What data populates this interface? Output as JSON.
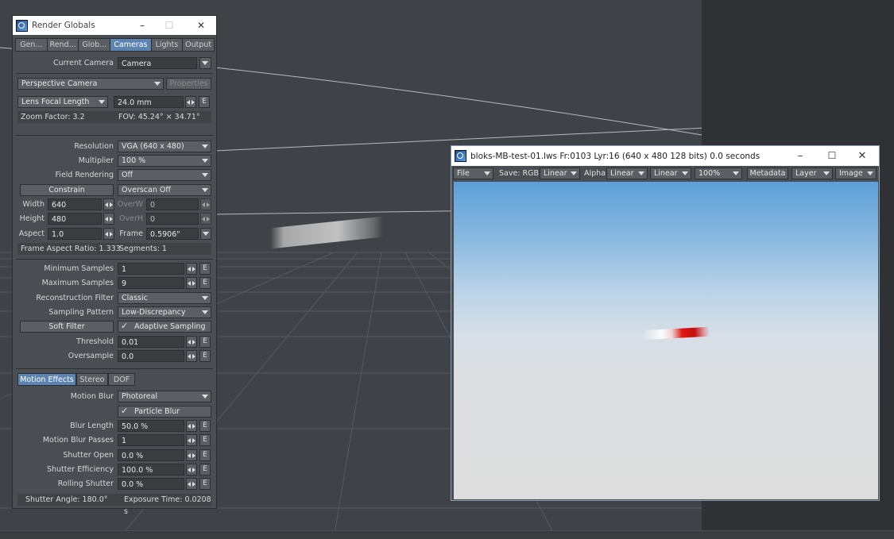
{
  "render_globals": {
    "title": "Render Globals",
    "tabs": [
      "Gen...",
      "Rend...",
      "Glob...",
      "Cameras",
      "Lights",
      "Output"
    ],
    "active_tab": "Cameras",
    "current_camera_label": "Current Camera",
    "current_camera_value": "Camera",
    "camera_type": "Perspective Camera",
    "properties_button": "Properties",
    "lens_mode": "Lens Focal Length",
    "lens_value": "24.0 mm",
    "zoom_factor": "Zoom Factor: 3.2",
    "fov": "FOV: 45.24° × 34.71°",
    "resolution": {
      "label": "Resolution",
      "value": "VGA (640 x 480)"
    },
    "multiplier": {
      "label": "Multiplier",
      "value": "100 %"
    },
    "field_rendering": {
      "label": "Field Rendering",
      "value": "Off"
    },
    "constrain_button": "Constrain",
    "overscan": "Overscan Off",
    "width": {
      "label": "Width",
      "value": "640"
    },
    "overw": {
      "label": "OverW",
      "value": "0"
    },
    "height": {
      "label": "Height",
      "value": "480"
    },
    "overh": {
      "label": "OverH",
      "value": "0"
    },
    "aspect": {
      "label": "Aspect",
      "value": "1.0"
    },
    "frame": {
      "label": "Frame",
      "value": "0.5906\""
    },
    "frame_aspect_ratio": "Frame Aspect Ratio: 1.333",
    "segments": "Segments: 1",
    "min_samples": {
      "label": "Minimum Samples",
      "value": "1"
    },
    "max_samples": {
      "label": "Maximum Samples",
      "value": "9"
    },
    "reconstruction_filter": {
      "label": "Reconstruction Filter",
      "value": "Classic"
    },
    "sampling_pattern": {
      "label": "Sampling Pattern",
      "value": "Low-Discrepancy"
    },
    "soft_filter_button": "Soft Filter",
    "adaptive_sampling": "Adaptive Sampling",
    "threshold": {
      "label": "Threshold",
      "value": "0.01"
    },
    "oversample": {
      "label": "Oversample",
      "value": "0.0"
    },
    "sub_tabs": [
      "Motion Effects",
      "Stereo",
      "DOF"
    ],
    "active_sub_tab": "Motion Effects",
    "motion_blur": {
      "label": "Motion Blur",
      "value": "Photoreal"
    },
    "particle_blur": "Particle Blur",
    "blur_length": {
      "label": "Blur Length",
      "value": "50.0 %"
    },
    "motion_blur_passes": {
      "label": "Motion Blur Passes",
      "value": "1"
    },
    "shutter_open": {
      "label": "Shutter Open",
      "value": "0.0 %"
    },
    "shutter_efficiency": {
      "label": "Shutter Efficiency",
      "value": "100.0 %"
    },
    "rolling_shutter": {
      "label": "Rolling Shutter",
      "value": "0.0 %"
    },
    "shutter_angle": "Shutter Angle: 180.0°",
    "exposure_time": "Exposure Time: 0.0208 s",
    "e_button": "E"
  },
  "render_window": {
    "title": "bloks-MB-test-01.lws Fr:0103 Lyr:16  (640 x 480 128 bits) 0.0 seconds",
    "file_menu": "File",
    "save_label": "Save: RGB",
    "color_space_1": "Linear",
    "alpha_label": "Alpha",
    "color_space_2": "Linear",
    "color_space_3": "Linear",
    "zoom": "100%",
    "metadata_button": "Metadata",
    "layer_menu": "Layer",
    "image_menu": "Image"
  },
  "colors": {
    "accent": "#5b84b1",
    "panel_bg": "#4a4d51",
    "viewport_bg": "#3f4246",
    "blur_red": "#e01414"
  }
}
